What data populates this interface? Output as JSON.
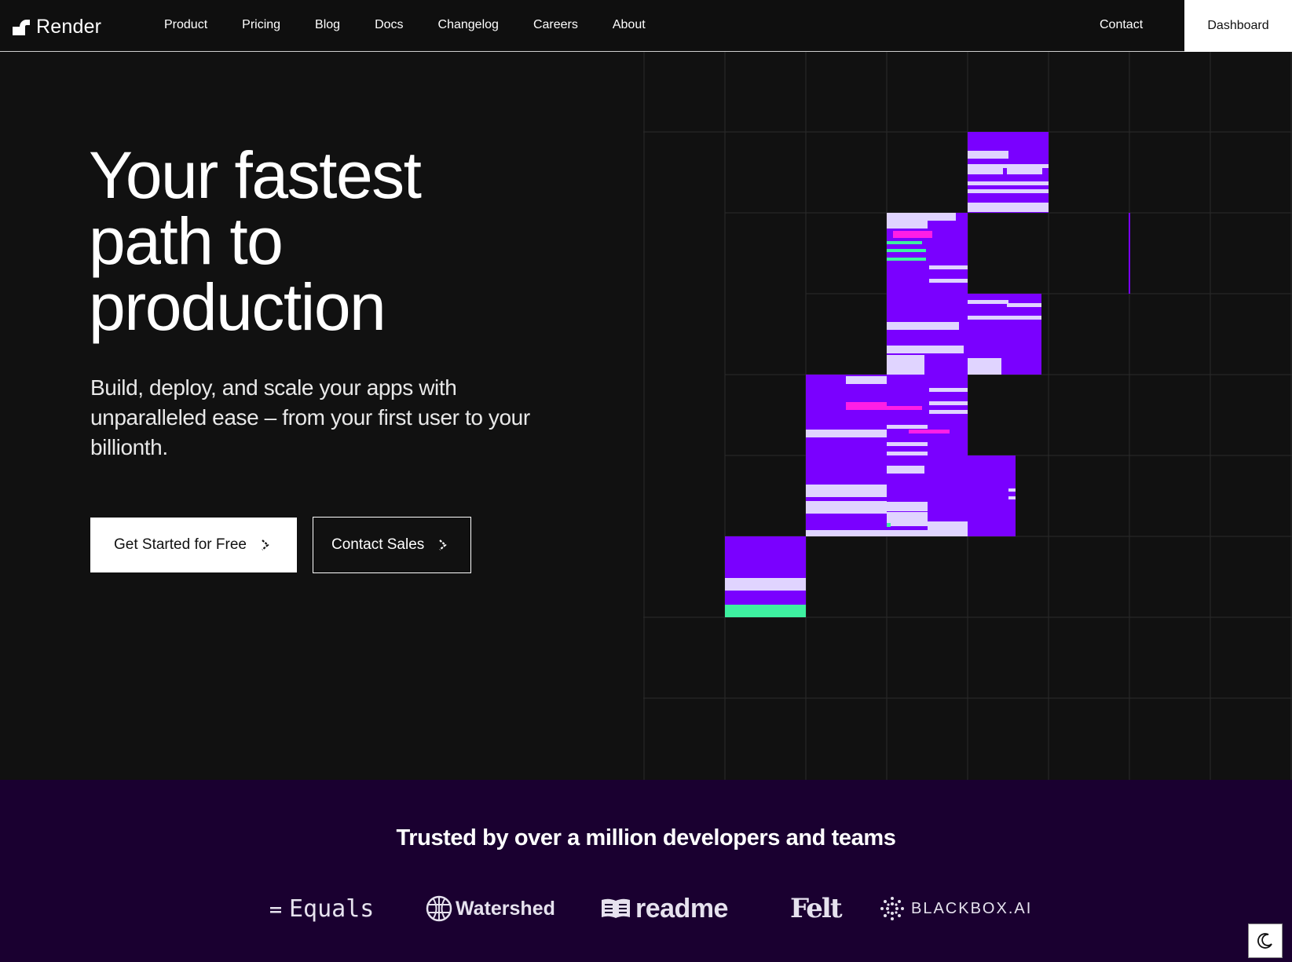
{
  "brand": {
    "name": "Render"
  },
  "nav": {
    "links": [
      "Product",
      "Pricing",
      "Blog",
      "Docs",
      "Changelog",
      "Careers",
      "About"
    ],
    "contact": "Contact",
    "dashboard": "Dashboard"
  },
  "hero": {
    "title": "Your fastest path to production",
    "subtitle": "Build, deploy, and scale your apps with unparalleled ease – from your first user to your billionth.",
    "primary_cta": "Get Started for Free",
    "secondary_cta": "Contact Sales"
  },
  "trust": {
    "title": "Trusted by over a million developers and teams",
    "logos": [
      "Equals",
      "Watershed",
      "readme",
      "Felt",
      "BLACKBOX.AI"
    ]
  },
  "colors": {
    "background": "#111111",
    "accent_purple": "#7a00ff",
    "accent_magenta": "#ff1ee6",
    "accent_green": "#3ef0a0",
    "lavender": "#e0d4ff",
    "trust_band": "#1a0030"
  },
  "icons": {
    "logo": "render-logo-icon",
    "arrow": "chevron-right-icon",
    "theme": "moon-icon"
  }
}
